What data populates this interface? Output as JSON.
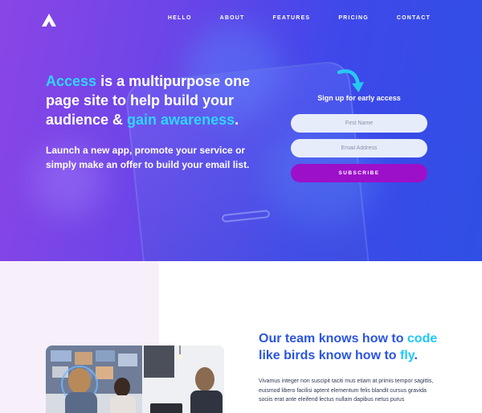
{
  "nav": {
    "items": [
      "HELLO",
      "ABOUT",
      "FEATURES",
      "PRICING",
      "CONTACT"
    ]
  },
  "hero": {
    "headline_hl1": "Access",
    "headline_mid": " is a multipurpose one page site to help build your audience & ",
    "headline_hl2": "gain awareness",
    "headline_end": ".",
    "subline": "Launch a new app, promote your service or simply make an offer to build your email list."
  },
  "signup": {
    "title": "Sign up for early access",
    "first_name_placeholder": "First Name",
    "email_placeholder": "Email Address",
    "subscribe_label": "SUBSCRIBE"
  },
  "team": {
    "h_part1": "Our team knows how to ",
    "h_hl1": "code",
    "h_part2": " like birds know how to ",
    "h_hl2": "fly",
    "h_end": ".",
    "body": "Vivamus integer non suscipit taciti mus etiam at primis tempor sagittis, euismod libero facilisi aptent elementum felis blandit cursus gravida sociis erat ante eleifend lectus nullam dapibus netus purus"
  },
  "colors": {
    "accent_cyan": "#2fd6ff",
    "subscribe_purple": "#9c10c9",
    "heading_blue": "#2b55e0"
  },
  "icons": {
    "logo": "triangle-logo-icon",
    "arrow": "curved-arrow-down-icon"
  }
}
